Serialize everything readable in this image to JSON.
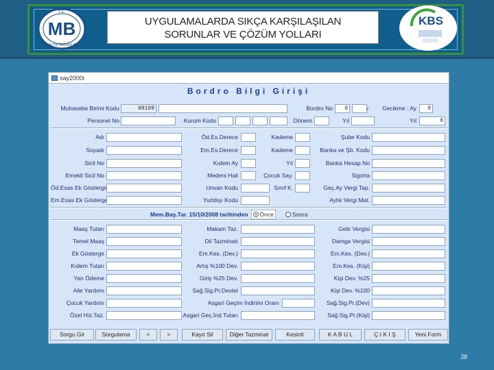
{
  "header": {
    "title_line1": "UYGULAMALARDA SIKÇA KARŞILAŞILAN",
    "title_line2": "SORUNLAR VE ÇÖZÜM YOLLARI",
    "logo_left_text": "MB",
    "logo_left_caption": "MALİYE BAKANLIĞI",
    "logo_left_top": "T.C.",
    "logo_right_text": "KBS"
  },
  "window": {
    "title": "say2000i",
    "heading": "Bordro Bilgi Girişi"
  },
  "top_section": {
    "muhasebe_label": "Muhasebe Birimi Kodu",
    "muhasebe_value": "99199",
    "bordro_label": "Bordro No",
    "bordro_value": "0",
    "ay_label": "Ay",
    "gecikme_label": "Gecikme : Ay",
    "gecikme_value": "0",
    "personel_label": "Personel No",
    "kurum_label": "Kurum Kodu",
    "donem_label": "Dönem",
    "yil_label": "Yıl",
    "yil2_label": "Yıl",
    "yil2_value": "0"
  },
  "person_section": {
    "adi": "Adı",
    "soyadi": "Soyadı",
    "sicil_no": "Sicil No",
    "emekli_sicil": "Emekli Sicil No",
    "od_ek_gost": "Öd.Esas Ek Gösterge",
    "em_ek_gost": "Em.Esas Ek Gösterge",
    "od_derece": "Öd.Es.Derece",
    "em_derece": "Em.Es.Derece",
    "kidem_ay": "Kıdem Ay",
    "medeni_hali": "Medeni Hali",
    "unvan_kodu": "Unvan Kodu",
    "yurtdisi_kodu": "Yurtdışı Kodu",
    "kademe1": "Kademe",
    "kademe2": "Kademe",
    "yil": "Yıl",
    "cocuk_say": "Çocuk Say.",
    "sinif_k": "Sınıf K.",
    "sube_kodu": "Şube Kodu",
    "banka_sb_kodu": "Banka ve Şb. Kodu",
    "banka_hesap": "Banka Hesap No",
    "sigorta": "Sigorta",
    "gec_ay_vergi": "Geç.Ay Vergi Tap.",
    "aylik_vergi": "Aylık Vergi Mat."
  },
  "date_row": {
    "label": "Mem.Baş.Tar. 15/10/2008 tarihinden",
    "opt_once": "Önce",
    "opt_sonra": "Sonra"
  },
  "payment_section": {
    "maas_tutari": "Maaş Tutarı",
    "temel_maas": "Temel Maaş",
    "ek_gosterge": "Ek Gösterge",
    "kidem_tutari": "Kıdem Tutarı",
    "yan_odeme": "Yan Ödeme",
    "aile_yardimi": "Aile Yardımı",
    "cocuk_yardimi": "Çocuk Yardımı",
    "ozel_hiz_taz": "Özel Hiz.Taz.",
    "makam_taz": "Makam Taz.",
    "dil_tazminati": "Dil Tazminatı",
    "em_kes_dev": "Em.Kes. (Dev.)",
    "artis_100_dev": "Artış %100 Dev.",
    "giris_25_dev": "Giriş %25 Dev.",
    "sag_sig_pr_dev": "Sağ.Sig.Pr.Devlet",
    "asgari_gecim_orani": "Asgari Geçim İndirimi Oranı",
    "asgari_gecim": "Asgari Geç.İnd.Tutarı",
    "gelir_vergisi": "Gelir Vergisi",
    "damga_vergisi": "Damga Vergisi",
    "em_kes_dev2": "Em.Kes. (Dev.)",
    "em_kes_kisi": "Em.Kes. (Kişi)",
    "kisi_dev_25": "Kişi Dev. %25",
    "kisi_dev_100": "Kişi Dev. %100",
    "sag_sig_pr_dev2": "Sağ.Sig.Pr.(Dev)",
    "sag_sig_pr_kisi": "Sağ.Sig.Pr.(Kişi)"
  },
  "buttons": {
    "sorgu_gir": "Sorgu Gir",
    "sorgula": "Sorgulama",
    "prev": "<",
    "next": ">",
    "kayit_sil": "Kayıt Sil",
    "diger_tazminat": "Diğer Tazminat",
    "kesinti": "Kesinti",
    "kabul": "K A B U L",
    "cikis": "Ç I K I Ş",
    "yeni_form": "Yeni Form"
  },
  "footer": {
    "page_number": "38"
  },
  "colors": {
    "background": "#2e7ba8",
    "window_bg": "#d6e5f7",
    "heading": "#1c3a8a",
    "label": "#2a2a6e"
  }
}
